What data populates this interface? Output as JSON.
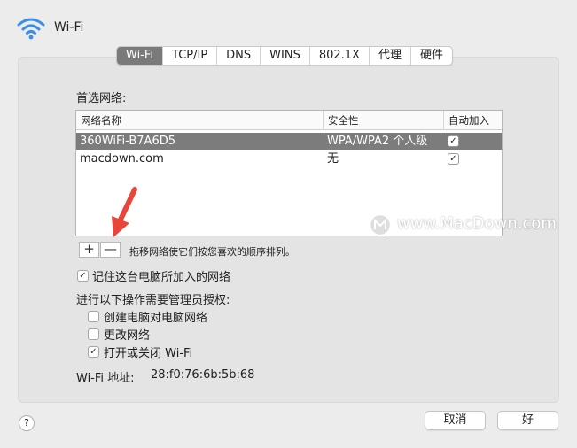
{
  "window": {
    "title": "Wi-Fi"
  },
  "tabs": [
    "Wi-Fi",
    "TCP/IP",
    "DNS",
    "WINS",
    "802.1X",
    "代理",
    "硬件"
  ],
  "active_tab": 0,
  "preferred_label": "首选网络:",
  "table": {
    "headers": [
      "网络名称",
      "安全性",
      "自动加入"
    ],
    "rows": [
      {
        "name": "360WiFi-B7A6D5",
        "security": "WPA/WPA2 个人级",
        "auto_join": true,
        "selected": true
      },
      {
        "name": "macdown.com",
        "security": "无",
        "auto_join": true,
        "selected": false
      }
    ]
  },
  "controls": {
    "add_label": "+",
    "remove_label": "—",
    "drag_hint": "拖移网络使它们按您喜欢的顺序排列。"
  },
  "remember": {
    "label": "记住这台电脑所加入的网络",
    "checked": true
  },
  "admin_label": "进行以下操作需要管理员授权:",
  "admin_options": [
    {
      "label": "创建电脑对电脑网络",
      "checked": false
    },
    {
      "label": "更改网络",
      "checked": false
    },
    {
      "label": "打开或关闭 Wi-Fi",
      "checked": true
    }
  ],
  "address": {
    "label": "Wi-Fi 地址:",
    "value": "28:f0:76:6b:5b:68"
  },
  "buttons": {
    "help": "?",
    "cancel": "取消",
    "ok": "好"
  },
  "watermark": "www.MacDown.com",
  "colors": {
    "selected_row": "#7c7c7c",
    "active_tab": "#7a7a7a",
    "arrow": "#e8463a"
  }
}
